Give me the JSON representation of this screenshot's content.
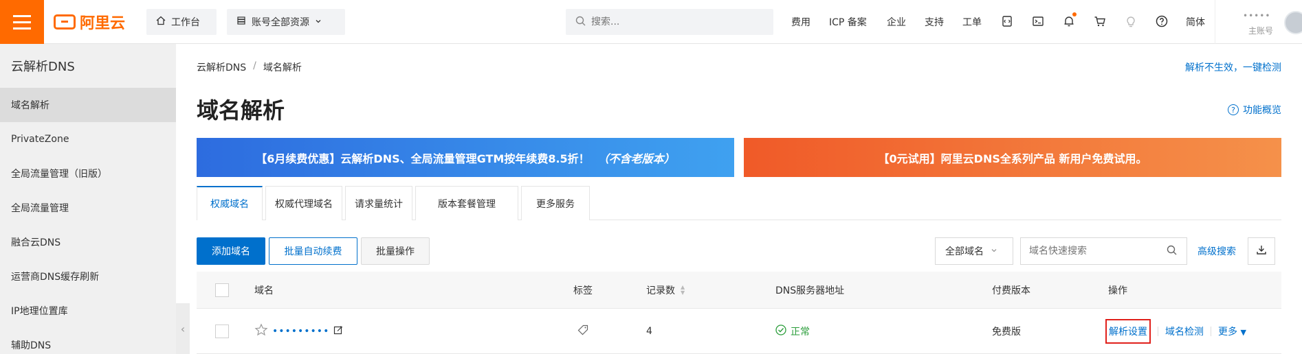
{
  "topbar": {
    "logo_text": "阿里云",
    "workbench": "工作台",
    "resources": "账号全部资源",
    "search_placeholder": "搜索...",
    "links": [
      "费用",
      "ICP 备案",
      "企业",
      "支持",
      "工单"
    ],
    "lang": "简体",
    "user_name": "•••••",
    "user_role": "主账号",
    "accent_color": "#ff6a00"
  },
  "sidebar": {
    "title": "云解析DNS",
    "items": [
      {
        "label": "域名解析",
        "active": true
      },
      {
        "label": "PrivateZone",
        "active": false
      },
      {
        "label": "全局流量管理（旧版）",
        "active": false
      },
      {
        "label": "全局流量管理",
        "active": false
      },
      {
        "label": "融合云DNS",
        "active": false
      },
      {
        "label": "运营商DNS缓存刷新",
        "active": false
      },
      {
        "label": "IP地理位置库",
        "active": false
      },
      {
        "label": "辅助DNS",
        "active": false
      }
    ]
  },
  "breadcrumb": {
    "root": "云解析DNS",
    "separator": "/",
    "current": "域名解析"
  },
  "header": {
    "check_link": "解析不生效，一键检测",
    "title": "域名解析",
    "overview_link": "功能概览"
  },
  "banners": {
    "blue_main": "【6月续费优惠】云解析DNS、全局流量管理GTM按年续费8.5折！",
    "blue_note": "（不含老版本）",
    "orange": "【0元试用】阿里云DNS全系列产品 新用户免费试用。"
  },
  "tabs": [
    {
      "label": "权威域名",
      "active": true
    },
    {
      "label": "权威代理域名",
      "active": false
    },
    {
      "label": "请求量统计",
      "active": false
    },
    {
      "label": "版本套餐管理",
      "active": false
    },
    {
      "label": "更多服务",
      "active": false
    }
  ],
  "toolbar": {
    "add_domain": "添加域名",
    "batch_renew": "批量自动续费",
    "batch_ops": "批量操作",
    "filter_value": "全部域名",
    "filter_placeholder": "域名快速搜索",
    "advanced_search": "高级搜索"
  },
  "table": {
    "columns": [
      "域名",
      "标签",
      "记录数",
      "DNS服务器地址",
      "付费版本",
      "操作"
    ],
    "rows": [
      {
        "domain": "•••••••••",
        "records": "4",
        "dns_status": "正常",
        "edition": "免费版",
        "ops": [
          "解析设置",
          "域名检测",
          "更多"
        ]
      }
    ]
  }
}
